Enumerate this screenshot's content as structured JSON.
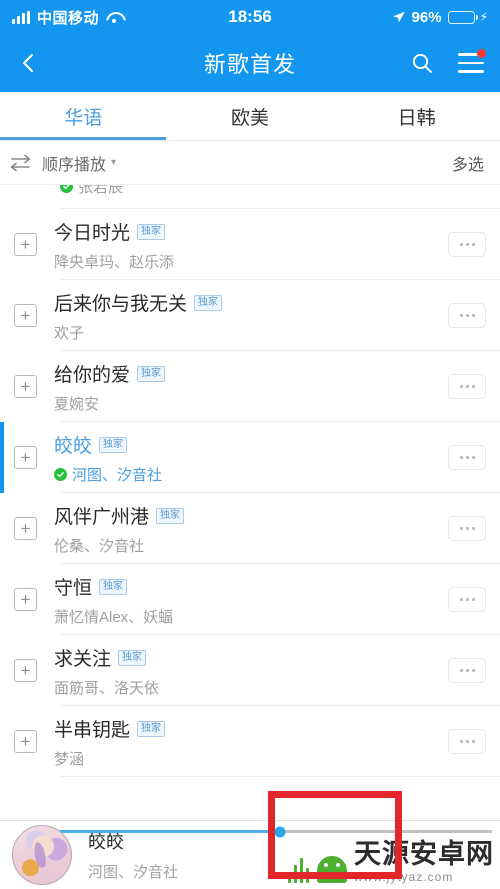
{
  "status_bar": {
    "carrier": "中国移动",
    "time": "18:56",
    "battery_percent": "96%",
    "battery_level": 96,
    "icons": [
      "signal-icon",
      "wifi-icon",
      "location-arrow-icon",
      "battery-icon",
      "charging-bolt-icon"
    ],
    "accent": "#1296f0"
  },
  "nav": {
    "title": "新歌首发",
    "back_icon": "back-chevron-icon",
    "search_icon": "search-icon",
    "menu_icon": "hamburger-menu-icon",
    "has_notification_dot": true
  },
  "tabs": {
    "items": [
      {
        "label": "华语",
        "active": true
      },
      {
        "label": "欧美",
        "active": false
      },
      {
        "label": "日韩",
        "active": false
      }
    ],
    "active_color": "#4a9fe0"
  },
  "toolbar": {
    "play_mode_label": "顺序播放",
    "play_mode_icon": "sequential-play-icon",
    "caret_icon": "chevron-down-icon",
    "multi_select_label": "多选"
  },
  "list": {
    "partial_top_row": {
      "artist": "张若辰",
      "verified": true
    },
    "rows": [
      {
        "title": "今日时光",
        "badge": "独家",
        "artist": "降央卓玛、赵乐添",
        "verified": false,
        "selected": false
      },
      {
        "title": "后来你与我无关",
        "badge": "独家",
        "artist": "欢子",
        "verified": false,
        "selected": false
      },
      {
        "title": "给你的爱",
        "badge": "独家",
        "artist": "夏婉安",
        "verified": false,
        "selected": false
      },
      {
        "title": "皎皎",
        "badge": "独家",
        "artist": "河图、汐音社",
        "verified": true,
        "selected": true
      },
      {
        "title": "风伴广州港",
        "badge": "独家",
        "artist": "伦桑、汐音社",
        "verified": false,
        "selected": false
      },
      {
        "title": "守恒",
        "badge": "独家",
        "artist": "萧忆情Alex、妖蝠",
        "verified": false,
        "selected": false
      },
      {
        "title": "求关注",
        "badge": "独家",
        "artist": "面筋哥、洛天依",
        "verified": false,
        "selected": false
      },
      {
        "title": "半串钥匙",
        "badge": "独家",
        "artist": "梦涵",
        "verified": false,
        "selected": false
      }
    ],
    "add_icon": "plus-icon",
    "more_icon": "more-options-icon"
  },
  "player": {
    "now_playing_title": "皎皎",
    "now_playing_artist": "河图、汐音社",
    "progress_percent": 53,
    "album_art_name": "album-art-thumbnail"
  },
  "watermark": {
    "site_name": "天源安卓网",
    "url": "www.jytyaz.com"
  },
  "annotation": {
    "shape": "red-rectangle-highlight",
    "color": "#e3262b"
  }
}
